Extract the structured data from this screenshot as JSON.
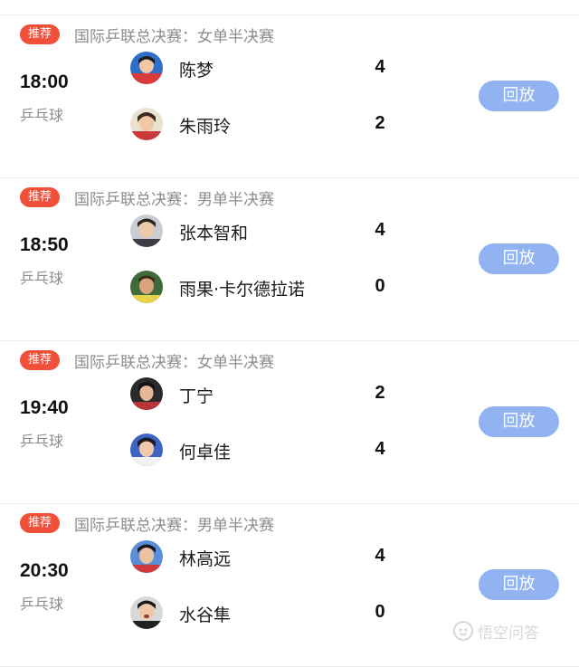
{
  "matches": [
    {
      "badge": "推荐",
      "event": "国际乒联总决赛：女单半决赛",
      "time": "18:00",
      "sport": "乒乓球",
      "players": [
        {
          "name": "陈梦",
          "score": "4"
        },
        {
          "name": "朱雨玲",
          "score": "2"
        }
      ],
      "replay_label": "回放"
    },
    {
      "badge": "推荐",
      "event": "国际乒联总决赛：男单半决赛",
      "time": "18:50",
      "sport": "乒乓球",
      "players": [
        {
          "name": "张本智和",
          "score": "4"
        },
        {
          "name": "雨果·卡尔德拉诺",
          "score": "0"
        }
      ],
      "replay_label": "回放"
    },
    {
      "badge": "推荐",
      "event": "国际乒联总决赛：女单半决赛",
      "time": "19:40",
      "sport": "乒乓球",
      "players": [
        {
          "name": "丁宁",
          "score": "2"
        },
        {
          "name": "何卓佳",
          "score": "4"
        }
      ],
      "replay_label": "回放"
    },
    {
      "badge": "推荐",
      "event": "国际乒联总决赛：男单半决赛",
      "time": "20:30",
      "sport": "乒乓球",
      "players": [
        {
          "name": "林高远",
          "score": "4"
        },
        {
          "name": "水谷隼",
          "score": "0"
        }
      ],
      "replay_label": "回放"
    }
  ],
  "watermark": {
    "text": "悟空问答"
  },
  "colors": {
    "badge": "#f0503a",
    "replay_button": "#91b3f2",
    "muted_text": "#8c8c8c",
    "divider": "#ececec"
  },
  "icons": {
    "avatar": "player-photo-icon",
    "watermark": "wukong-logo-icon"
  }
}
